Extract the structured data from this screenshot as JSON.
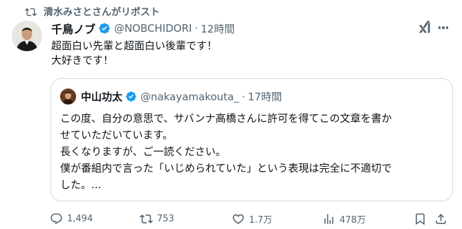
{
  "repost": {
    "icon": "repost-icon",
    "text": "清水みさとさんがリポスト"
  },
  "tweet": {
    "author_name": "千鳥ノブ",
    "author_handle": "@NOBCHIDORI",
    "separator": "·",
    "time": "12時間",
    "text_lines": [
      "超面白い先輩と超面白い後輩です！",
      "大好きです！"
    ]
  },
  "quote": {
    "author_name": "中山功太",
    "author_handle": "@nakayamakouta_",
    "separator": "·",
    "time": "17時間",
    "text_lines": [
      "この度、自分の意思で、サバンナ高橋さんに許可を得てこの文章を書か",
      "せていただいています。",
      "長くなりますが、ご一読ください。",
      "僕が番組内で言った「いじめられていた」という表現は完全に不適切で",
      "した。..."
    ]
  },
  "actions": {
    "replies": "1,494",
    "reposts": "753",
    "likes": "1.7万",
    "views": "478万"
  },
  "colors": {
    "text_primary": "#0f1419",
    "text_secondary": "#536471",
    "verified_blue": "#1d9bf0",
    "border": "#cfd9de",
    "repost_active": "#00ba7c"
  }
}
